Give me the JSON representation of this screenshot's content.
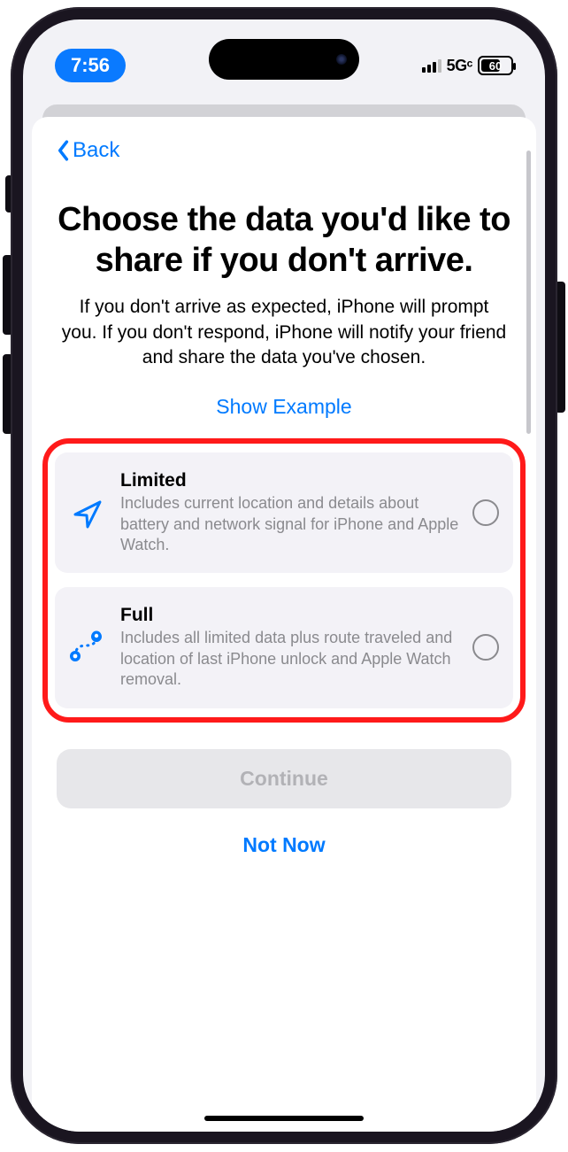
{
  "status": {
    "time": "7:56",
    "network": "5Gᶜ",
    "battery": "60"
  },
  "nav": {
    "back_label": "Back"
  },
  "header": {
    "title": "Choose the data you'd like to share if you don't arrive.",
    "subtitle": "If you don't arrive as expected, iPhone will prompt you. If you don't respond, iPhone will notify your friend and share the data you've chosen.",
    "show_example": "Show Example"
  },
  "options": {
    "limited": {
      "title": "Limited",
      "desc": "Includes current location and details about battery and network signal for iPhone and Apple Watch."
    },
    "full": {
      "title": "Full",
      "desc": "Includes all limited data plus route traveled and location of last iPhone unlock and Apple Watch removal."
    }
  },
  "buttons": {
    "continue": "Continue",
    "not_now": "Not Now"
  }
}
